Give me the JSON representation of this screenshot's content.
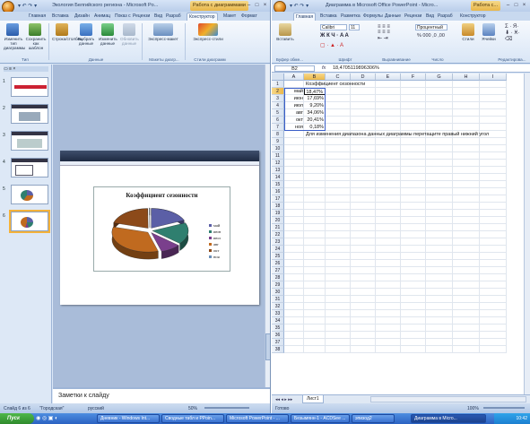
{
  "ppt": {
    "title": "Экология Белгийского региона - Microsoft Po...",
    "context_tab": "Работа с диаграммами",
    "qat": "▾ ↶ ↷ ▾",
    "tabs": [
      "Главная",
      "Вставка",
      "Дизайн",
      "Анимац",
      "Показ с",
      "Рецензи",
      "Вид",
      "Разраб",
      "Конструктор",
      "Макет",
      "Формат"
    ],
    "active_tab": "Конструктор",
    "ribbon": {
      "buttons": [
        "Изменить тип диаграммы",
        "Сохранить как шаблон",
        "Строка/столбец",
        "Выбрать данные",
        "Изменить данные",
        "Обновить данные",
        "Экспресс-макет",
        "Экспресс-стили"
      ],
      "groups": [
        "Тип",
        "Данные",
        "Макеты диагр...",
        "Стили диаграмм"
      ]
    },
    "thumb_numbers": [
      "1",
      "2",
      "3",
      "4",
      "5",
      "6"
    ],
    "chart_title": "Коэффициент сезонности",
    "notes_placeholder": "Заметки к слайду",
    "status": {
      "slide": "Слайд 6 из 6",
      "theme": "\"Городская\"",
      "lang": "русский",
      "zoom": "50%"
    }
  },
  "excel": {
    "title": "Диаграмма в Microsoft Office PowerPoint - Micro...",
    "context_tab": "Работа с...",
    "qat": "▾ ↶ ↷ ▾",
    "tabs": [
      "Главная",
      "Вставка",
      "Разметка",
      "Формулы",
      "Данные",
      "Рецензи",
      "Вид",
      "Разраб",
      "Конструктор"
    ],
    "ribbon": {
      "buttons": [
        "Вставить",
        "Calibri",
        "11",
        "Процентный",
        "Стили",
        "Ячейки"
      ],
      "groups": [
        "Буфер обме...",
        "Шрифт",
        "Выравнивание",
        "Число",
        "Редактирова..."
      ]
    },
    "name_box": "B2",
    "fx": "fx",
    "formula": "18,4705119896306%",
    "columns": [
      "A",
      "B",
      "C",
      "D",
      "E",
      "F",
      "G",
      "H",
      "I"
    ],
    "rows": [
      "1",
      "2",
      "3",
      "4",
      "5",
      "6",
      "7",
      "8",
      "9",
      "10",
      "11",
      "12",
      "13",
      "14",
      "15",
      "16",
      "17",
      "18",
      "19",
      "20",
      "21",
      "22",
      "23",
      "24",
      "25",
      "26",
      "27",
      "28",
      "29",
      "30",
      "31",
      "32",
      "33",
      "34",
      "35",
      "36",
      "37",
      "38"
    ],
    "header_cell": "Коэффициент сезонности",
    "data_rows": [
      {
        "label": "май",
        "value": "18,47%"
      },
      {
        "label": "июн",
        "value": "17,69%"
      },
      {
        "label": "июл",
        "value": "9,20%"
      },
      {
        "label": "авг",
        "value": "34,06%"
      },
      {
        "label": "окт",
        "value": "20,41%"
      },
      {
        "label": "ноя",
        "value": "0,18%"
      }
    ],
    "note": "Для изменения диапазона данных диаграммы перетащите правый нижний угол",
    "sheet_tab": "Лист1",
    "status": {
      "ready": "Готово",
      "zoom": "100%"
    }
  },
  "chart_data": {
    "type": "pie",
    "title": "Коэффициент сезонности",
    "categories": [
      "май",
      "июн",
      "июл",
      "авг",
      "окт",
      "ноя"
    ],
    "values": [
      18.47,
      17.69,
      9.2,
      34.06,
      20.41,
      0.18
    ],
    "legend_labels": [
      "май",
      "июн",
      "июл",
      "авг",
      "окт",
      "ноя"
    ],
    "colors": [
      "#5b5fa6",
      "#2f7f6f",
      "#7a3f8c",
      "#c06a1f",
      "#8c4a1a",
      "#6b8fb8"
    ],
    "legend": "right"
  },
  "taskbar": {
    "start": "Пуск",
    "tasks": [
      "Дневник - Windows Int...",
      "Сводные табл и PPoin...",
      "Microsoft PowerPoint - ...",
      "Безымянн-1 - ACDSee ...",
      "эпизод2",
      "Диаграмма в Micro..."
    ],
    "active_task": "Диаграмма в Micro...",
    "clock": "10:42"
  },
  "theme": {
    "accent": "#f4b23a",
    "chrome": "#dbe7f6"
  }
}
